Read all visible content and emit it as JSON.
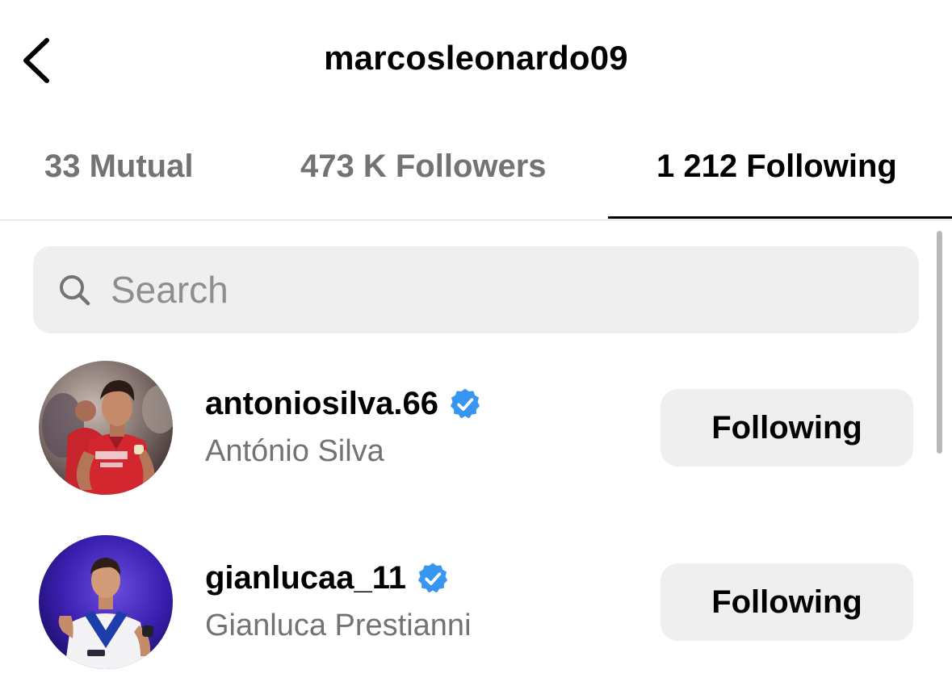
{
  "header": {
    "title": "marcosleonardo09",
    "back_icon": "chevron-left-icon"
  },
  "tabs": [
    {
      "label": "33 Mutual",
      "active": false
    },
    {
      "label": "473 K Followers",
      "active": false
    },
    {
      "label": "1 212 Following",
      "active": true
    }
  ],
  "search": {
    "placeholder": "Search",
    "value": "",
    "icon": "search-icon"
  },
  "accounts": [
    {
      "username": "antoniosilva.66",
      "full_name": "António Silva",
      "verified": true,
      "button_label": "Following",
      "avatar": "avatar-photo"
    },
    {
      "username": "gianlucaa_11",
      "full_name": "Gianluca Prestianni",
      "verified": true,
      "button_label": "Following",
      "avatar": "avatar-photo"
    }
  ],
  "colors": {
    "verified_badge": "#3797f0",
    "secondary_text": "#737373",
    "button_bg": "#efefef",
    "search_bg": "#efefef",
    "divider": "#dbdbdb"
  }
}
